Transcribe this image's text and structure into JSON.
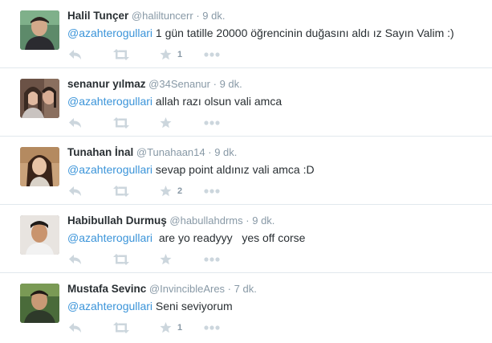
{
  "colors": {
    "name": "#292f33",
    "meta": "#8899a6",
    "mention": "#3b94d9",
    "icon": "#ccd6dd",
    "divider": "#e1e8ed"
  },
  "tweets": [
    {
      "fullname": "Halil Tunçer",
      "username": "@haliltuncerr",
      "separator": "·",
      "time": "9 dk.",
      "mention": "@azahterogullari",
      "text": " 1 gün tatille 20000 öğrencinin duğasını aldı ız Sayın Valim :)",
      "fav_count": "1"
    },
    {
      "fullname": "senanur yılmaz",
      "username": "@34Senanur",
      "separator": "·",
      "time": "9 dk.",
      "mention": "@azahterogullari",
      "text": " allah razı olsun vali amca",
      "fav_count": ""
    },
    {
      "fullname": "Tunahan İnal",
      "username": "@Tunahaan14",
      "separator": "·",
      "time": "9 dk.",
      "mention": "@azahterogullari",
      "text": " sevap point aldınız vali amca :D",
      "fav_count": "2"
    },
    {
      "fullname": "Habibullah Durmuş",
      "username": "@habullahdrms",
      "separator": "·",
      "time": "9 dk.",
      "mention": "@azahterogullari",
      "text": "  are yo readyyy   yes off corse",
      "fav_count": ""
    },
    {
      "fullname": "Mustafa Sevinc",
      "username": "@InvincibleAres",
      "separator": "·",
      "time": "7 dk.",
      "mention": "@azahterogullari",
      "text": " Seni seviyorum",
      "fav_count": "1"
    }
  ],
  "icons": {
    "reply": "reply-icon",
    "retweet": "retweet-icon",
    "favorite": "star-icon",
    "more": "more-icon"
  }
}
